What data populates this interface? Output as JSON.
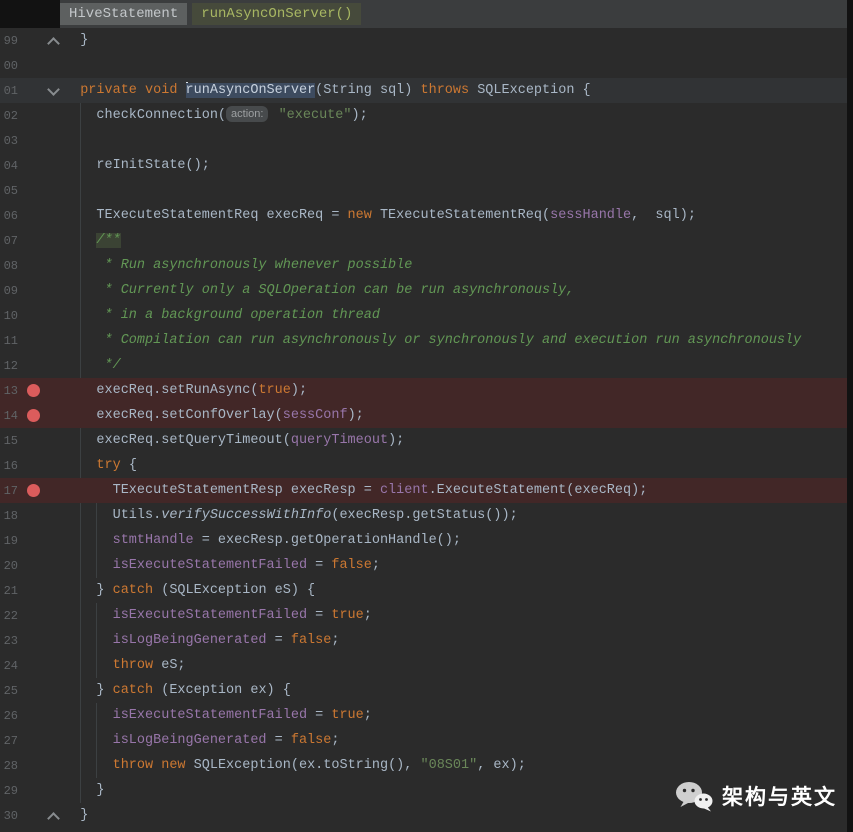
{
  "tabs": {
    "file": "HiveStatement",
    "method": "runAsyncOnServer()"
  },
  "watermark": {
    "text": "架构与英文",
    "icon": "wechat-icon"
  },
  "colors": {
    "bg": "#2b2b2b",
    "topbar-bg": "#3b3d3e",
    "tab-file-bg": "#5d6060",
    "tab-file-fg": "#c3c7ca",
    "tab-method-bg": "#464a3b",
    "tab-method-fg": "#a8b763",
    "text": "#a9b7c6",
    "keyword": "#cc7832",
    "string": "#6a8759",
    "comment": "#629755",
    "field": "#9876aa",
    "line-num": "#606366",
    "bp": "#db5c5c",
    "bp-line": "#422727",
    "caret-line": "#313335",
    "hl-bg": "#3d4b5f",
    "hint-bg": "#474a4c",
    "hint-fg": "#9da0a2"
  },
  "editor": {
    "lines": [
      {
        "num": "99",
        "fold": "up",
        "segs": [
          [
            "d",
            "  }"
          ]
        ]
      },
      {
        "num": "00",
        "segs": []
      },
      {
        "num": "01",
        "bg": "caretline",
        "fold": "down",
        "segs": [
          [
            "d",
            "  "
          ],
          [
            "k",
            "private"
          ],
          [
            "d",
            " "
          ],
          [
            "k",
            "void"
          ],
          [
            "d",
            " "
          ],
          [
            "caret",
            ""
          ],
          [
            "hl",
            "runAsyncOnServer"
          ],
          [
            "d",
            "(String sql) "
          ],
          [
            "k",
            "throws"
          ],
          [
            "d",
            " SQLException {"
          ]
        ]
      },
      {
        "num": "02",
        "segs": [
          [
            "d",
            "    checkConnection("
          ],
          [
            "hint",
            "action:"
          ],
          [
            "d",
            " "
          ],
          [
            "s",
            "\"execute\""
          ],
          [
            "d",
            ");"
          ]
        ]
      },
      {
        "num": "03",
        "segs": []
      },
      {
        "num": "04",
        "segs": [
          [
            "d",
            "    reInitState();"
          ]
        ]
      },
      {
        "num": "05",
        "segs": []
      },
      {
        "num": "06",
        "segs": [
          [
            "d",
            "    TExecuteStatementReq execReq = "
          ],
          [
            "k",
            "new"
          ],
          [
            "d",
            " TExecuteStatementReq("
          ],
          [
            "f",
            "sessHandle"
          ],
          [
            "d",
            ",  sql);"
          ]
        ]
      },
      {
        "num": "07",
        "segs": [
          [
            "d",
            "    "
          ],
          [
            "cmo",
            "/**"
          ]
        ]
      },
      {
        "num": "08",
        "segs": [
          [
            "c",
            "     * Run asynchronously whenever possible"
          ]
        ]
      },
      {
        "num": "09",
        "segs": [
          [
            "c",
            "     * Currently only a SQLOperation can be run asynchronously,"
          ]
        ]
      },
      {
        "num": "10",
        "segs": [
          [
            "c",
            "     * in a background operation thread"
          ]
        ]
      },
      {
        "num": "11",
        "segs": [
          [
            "c",
            "     * Compilation can run asynchronously or synchronously and execution run asynchronously"
          ]
        ]
      },
      {
        "num": "12",
        "segs": [
          [
            "c",
            "     */"
          ]
        ]
      },
      {
        "num": "13",
        "bg": "bpline",
        "bp": true,
        "segs": [
          [
            "d",
            "    execReq.setRunAsync("
          ],
          [
            "k",
            "true"
          ],
          [
            "d",
            ");"
          ]
        ]
      },
      {
        "num": "14",
        "bg": "bpline",
        "bp": true,
        "segs": [
          [
            "d",
            "    execReq.setConfOverlay("
          ],
          [
            "f",
            "sessConf"
          ],
          [
            "d",
            ");"
          ]
        ]
      },
      {
        "num": "15",
        "segs": [
          [
            "d",
            "    execReq.setQueryTimeout("
          ],
          [
            "f",
            "queryTimeout"
          ],
          [
            "d",
            ");"
          ]
        ]
      },
      {
        "num": "16",
        "segs": [
          [
            "d",
            "    "
          ],
          [
            "k",
            "try"
          ],
          [
            "d",
            " {"
          ]
        ]
      },
      {
        "num": "17",
        "bg": "bpline",
        "bp": true,
        "segs": [
          [
            "d",
            "      TExecuteStatementResp execResp = "
          ],
          [
            "f",
            "client"
          ],
          [
            "d",
            ".ExecuteStatement(execReq);"
          ]
        ]
      },
      {
        "num": "18",
        "segs": [
          [
            "d",
            "      Utils."
          ],
          [
            "i",
            "verifySuccessWithInfo"
          ],
          [
            "d",
            "(execResp.getStatus());"
          ]
        ]
      },
      {
        "num": "19",
        "segs": [
          [
            "d",
            "      "
          ],
          [
            "f",
            "stmtHandle"
          ],
          [
            "d",
            " = execResp.getOperationHandle();"
          ]
        ]
      },
      {
        "num": "20",
        "segs": [
          [
            "d",
            "      "
          ],
          [
            "f",
            "isExecuteStatementFailed"
          ],
          [
            "d",
            " = "
          ],
          [
            "k",
            "false"
          ],
          [
            "d",
            ";"
          ]
        ]
      },
      {
        "num": "21",
        "segs": [
          [
            "d",
            "    } "
          ],
          [
            "k",
            "catch"
          ],
          [
            "d",
            " (SQLException eS) {"
          ]
        ]
      },
      {
        "num": "22",
        "segs": [
          [
            "d",
            "      "
          ],
          [
            "f",
            "isExecuteStatementFailed"
          ],
          [
            "d",
            " = "
          ],
          [
            "k",
            "true"
          ],
          [
            "d",
            ";"
          ]
        ]
      },
      {
        "num": "23",
        "segs": [
          [
            "d",
            "      "
          ],
          [
            "f",
            "isLogBeingGenerated"
          ],
          [
            "d",
            " = "
          ],
          [
            "k",
            "false"
          ],
          [
            "d",
            ";"
          ]
        ]
      },
      {
        "num": "24",
        "segs": [
          [
            "d",
            "      "
          ],
          [
            "k",
            "throw"
          ],
          [
            "d",
            " eS;"
          ]
        ]
      },
      {
        "num": "25",
        "segs": [
          [
            "d",
            "    } "
          ],
          [
            "k",
            "catch"
          ],
          [
            "d",
            " (Exception ex) {"
          ]
        ]
      },
      {
        "num": "26",
        "segs": [
          [
            "d",
            "      "
          ],
          [
            "f",
            "isExecuteStatementFailed"
          ],
          [
            "d",
            " = "
          ],
          [
            "k",
            "true"
          ],
          [
            "d",
            ";"
          ]
        ]
      },
      {
        "num": "27",
        "segs": [
          [
            "d",
            "      "
          ],
          [
            "f",
            "isLogBeingGenerated"
          ],
          [
            "d",
            " = "
          ],
          [
            "k",
            "false"
          ],
          [
            "d",
            ";"
          ]
        ]
      },
      {
        "num": "28",
        "segs": [
          [
            "d",
            "      "
          ],
          [
            "k",
            "throw"
          ],
          [
            "d",
            " "
          ],
          [
            "k",
            "new"
          ],
          [
            "d",
            " SQLException(ex.toString(), "
          ],
          [
            "s",
            "\"08S01\""
          ],
          [
            "d",
            ", ex);"
          ]
        ]
      },
      {
        "num": "29",
        "segs": [
          [
            "d",
            "    }"
          ]
        ]
      },
      {
        "num": "30",
        "fold": "up",
        "segs": [
          [
            "d",
            "  }"
          ]
        ]
      }
    ]
  }
}
